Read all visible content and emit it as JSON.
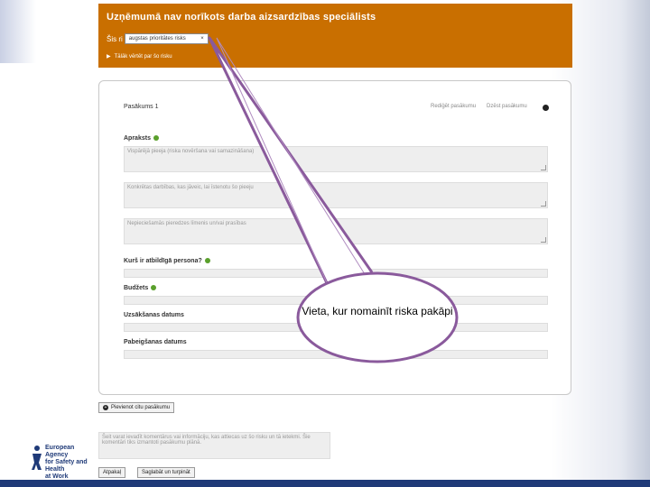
{
  "header": {
    "title": "Uzņēmumā nav norīkots darba aizsardzības speciālists",
    "risk_prefix": "Šis ri",
    "risk_select_value": "augstas prioritātes risks",
    "risk_select_arrow": "×",
    "assess_link": "Tālāk vērtēt par šo risku"
  },
  "measure": {
    "title": "Pasākums 1",
    "actions": [
      "Rediģēt pasākumu",
      "Dzēst pasākumu"
    ]
  },
  "fields": {
    "description_label": "Apraksts",
    "textarea1_placeholder": "Vispārējā pieeja (riska novēršana vai samazināšana)",
    "textarea2_placeholder": "Konkrētas darbības, kas jāveic, lai īstenotu šo pieeju",
    "textarea3_placeholder": "Nepieciešamās pieredzes līmenis un/vai prasības",
    "responsible_label": "Kurš ir atbildīgā persona?",
    "budget_label": "Budžets",
    "start_label": "Uzsākšanas datums",
    "end_label": "Pabeigšanas datums"
  },
  "buttons": {
    "add_measure": "Pievienot citu pasākumu",
    "back": "Atpakaļ",
    "save_continue": "Saglabāt un turpināt"
  },
  "comment_placeholder": "Šeit varat ievadīt komentārus vai informāciju, kas attiecas uz šo risku un tā ietekmi. Šie komentāri tiks izmantoti pasākumu plānā.",
  "logo": {
    "lines": [
      "European Agency",
      "for Safety and Health",
      "at Work"
    ]
  },
  "callout": {
    "text": "Vieta, kur nomainīt riska pakāpi"
  },
  "colors": {
    "header_bg": "#c96f00",
    "callout_border": "#8a5a9c",
    "accent_navy": "#1f3a78"
  }
}
